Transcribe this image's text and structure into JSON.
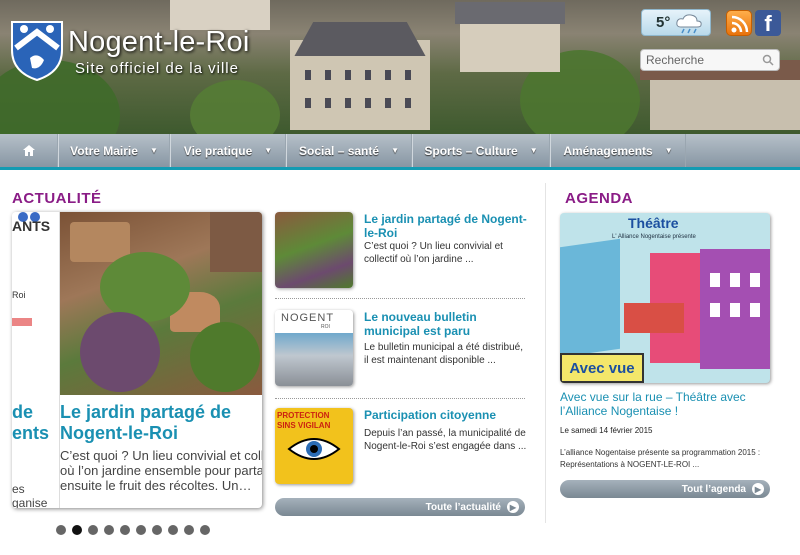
{
  "header": {
    "title": "Nogent-le-Roi",
    "subtitle": "Site officiel de la ville",
    "weather_temp": "5°",
    "facebook_letter": "f",
    "search_placeholder": "Recherche"
  },
  "nav": {
    "items": [
      {
        "label": "Votre Mairie"
      },
      {
        "label": "Vie pratique"
      },
      {
        "label": "Social – santé"
      },
      {
        "label": "Sports – Culture"
      },
      {
        "label": "Aménagements"
      }
    ]
  },
  "actualite": {
    "section_title": "ACTUALITÉ",
    "prev_slide_fragments": [
      "ANTS",
      "Roi",
      "de",
      "ents",
      "es",
      "ganise"
    ],
    "slide": {
      "title": "Le jardin partagé de Nogent-le-Roi",
      "text": "C’est quoi ? Un lieu convivial et colle\noù l’on jardine ensemble pour partag\nensuite le fruit des récoltes. Un…"
    },
    "dots_count": 10,
    "active_dot": 1,
    "news": [
      {
        "title": "Le jardin partagé de Nogent-le-Roi",
        "text": "C’est quoi ? Un lieu convivial et collectif où l’on jardine ..."
      },
      {
        "title": "Le nouveau bulletin municipal est paru",
        "text": "Le bulletin municipal a été distribué, il est maintenant disponible ...",
        "thumb_text": "NOGENT",
        "thumb_sub": "ROI"
      },
      {
        "title": "Participation citoyenne",
        "text": "Depuis l’an passé, la municipalité de Nogent-le-Roi s’est engagée dans ...",
        "thumb_text": "PROTECTION",
        "thumb_text2": "SINS VIGILAN"
      }
    ],
    "all_news_label": "Toute l’actualité"
  },
  "agenda": {
    "section_title": "AGENDA",
    "poster_title": "Théâtre",
    "poster_sub": "L' Alliance Nogentaise présente",
    "poster_caption": "Avec vue",
    "event_title": "Avec vue sur la rue – Théâtre avec l’Alliance Nogentaise !",
    "event_date": "Le samedi 14 février 2015",
    "event_desc": "L’alliance Nogentaise présente sa programmation 2015 : Représentations à NOGENT-LE-ROI ...",
    "all_agenda_label": "Tout l’agenda"
  },
  "colors": {
    "accent_teal": "#139bb2",
    "link_blue": "#1a90b2",
    "section_purple": "#8a1c86"
  }
}
